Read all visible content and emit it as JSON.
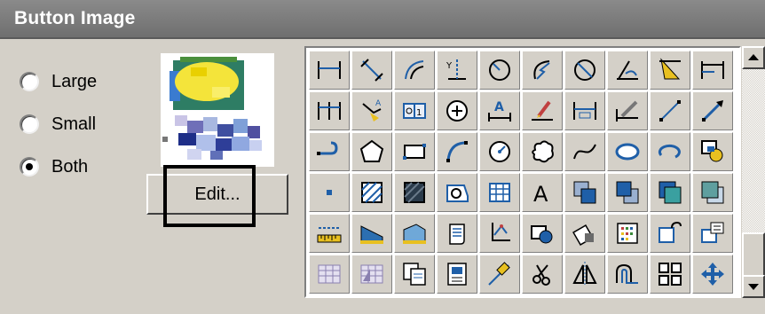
{
  "title": "Button Image",
  "size_options": [
    {
      "label": "Large",
      "selected": false
    },
    {
      "label": "Small",
      "selected": false
    },
    {
      "label": "Both",
      "selected": true
    }
  ],
  "edit_button": {
    "label": "Edit..."
  },
  "icon_grid": [
    [
      "dim-linear-icon",
      "dim-aligned-icon",
      "dim-arc-icon",
      "dim-ordinate-icon",
      "dim-radius-icon",
      "dim-jogged-icon",
      "dim-diameter-icon",
      "dim-angular-icon",
      "quick-dim-icon",
      "dim-baseline-icon"
    ],
    [
      "dim-continue-icon",
      "quick-leader-icon",
      "tolerance-icon",
      "center-mark-icon",
      "dim-edit-icon",
      "dim-text-edit-icon",
      "dim-update-icon",
      "dim-style-icon",
      "line-icon",
      "ray-icon"
    ],
    [
      "polyline-icon",
      "polygon-icon",
      "rectangle-icon",
      "arc-icon",
      "circle-icon",
      "revcloud-icon",
      "spline-icon",
      "ellipse-icon",
      "ellipse-arc-icon",
      "insert-block-icon"
    ],
    [
      "point-icon",
      "hatch-icon",
      "gradient-icon",
      "region-icon",
      "table-icon",
      "mtext-icon",
      "bring-front-icon",
      "send-back-icon",
      "bring-above-icon",
      "send-under-icon"
    ],
    [
      "ruler-icon",
      "wedge-icon",
      "box-icon",
      "scroll-icon",
      "ucs-icon",
      "make-block-icon",
      "paste-icon",
      "attribute-icon",
      "attribute-edit-icon",
      "define-attribute-icon"
    ],
    [
      "layer-grid-icon",
      "layer-grid-alt-icon",
      "copy-clip-icon",
      "paste-special-icon",
      "erase-icon",
      "scissors-icon",
      "mirror-icon",
      "offset-icon",
      "array-icon",
      "move-icon"
    ]
  ],
  "scrollbar": {
    "up_icon": "arrow-up-icon",
    "down_icon": "arrow-down-icon"
  },
  "colors": {
    "titlebar": "#7b7b7b",
    "window": "#d4d0c8",
    "icon_blue": "#1f5fa8"
  }
}
